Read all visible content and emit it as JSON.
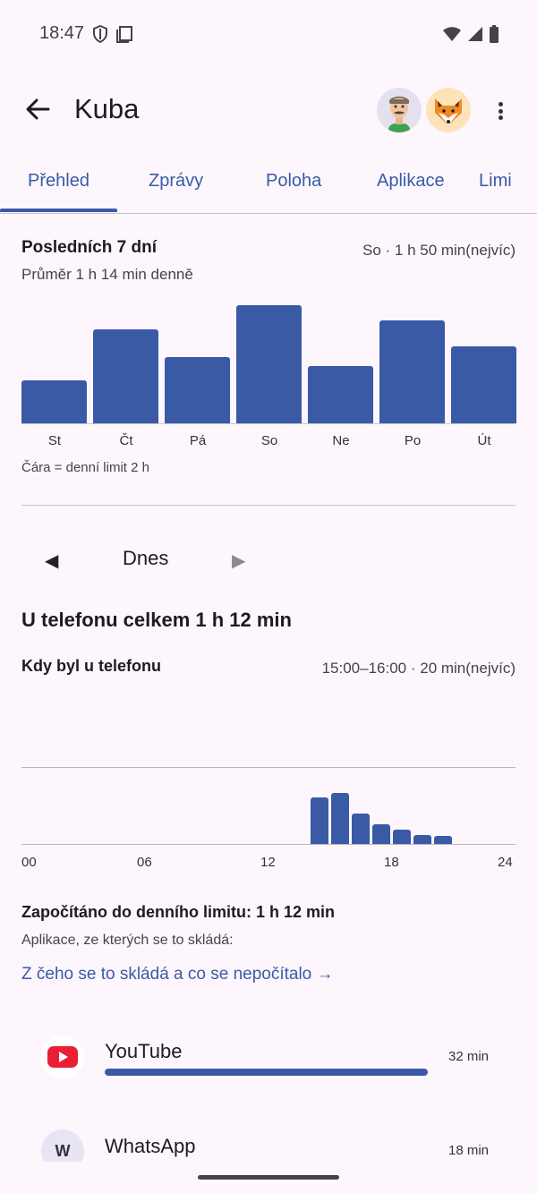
{
  "status": {
    "time": "18:47"
  },
  "header": {
    "title": "Kuba"
  },
  "tabs": [
    {
      "label": "Přehled",
      "active": true
    },
    {
      "label": "Zprávy"
    },
    {
      "label": "Poloha"
    },
    {
      "label": "Aplikace"
    },
    {
      "label": "Limi"
    }
  ],
  "week": {
    "title": "Posledních 7 dní",
    "peak": "So · 1 h 50 min(nejvíc)",
    "average": "Průměr 1 h 14 min denně",
    "legend": "Čára = denní limit 2 h"
  },
  "day_nav": {
    "label": "Dnes",
    "prev_icon": "◀",
    "next_icon": "▶"
  },
  "today": {
    "total": "U telefonu celkem 1 h 12 min",
    "when_title": "Kdy byl u telefonu",
    "when_peak": "15:00–16:00 · 20 min(nejvíc)"
  },
  "limit": {
    "counted": "Započítáno do denního limitu: 1 h 12 min",
    "apps_intro": "Aplikace, ze kterých se to skládá:",
    "details_link": "Z čeho se to skládá a co se nepočítalo →"
  },
  "apps": [
    {
      "name": "YouTube",
      "time": "32 min",
      "icon": "youtube-icon"
    },
    {
      "name": "WhatsApp",
      "time": "18 min",
      "icon": "whatsapp-icon",
      "initial": "W"
    }
  ],
  "colors": {
    "accent": "#3a5aa6",
    "background": "#fdf7fd"
  },
  "chart_data": [
    {
      "type": "bar",
      "categories": [
        "St",
        "Čt",
        "Pá",
        "So",
        "Ne",
        "Po",
        "Út"
      ],
      "values": [
        48,
        106,
        75,
        133,
        64,
        116,
        87
      ],
      "unit": "min",
      "ylim": [
        0,
        133
      ]
    },
    {
      "type": "bar",
      "categories": [
        "00",
        "06",
        "12",
        "18",
        "24"
      ],
      "x": [
        14,
        15,
        16,
        17,
        18,
        19,
        20
      ],
      "values": [
        18,
        20,
        12,
        7.5,
        5.5,
        3.5,
        3
      ],
      "unit": "min",
      "xlim": [
        0,
        24
      ],
      "ylim": [
        0,
        30
      ]
    }
  ]
}
